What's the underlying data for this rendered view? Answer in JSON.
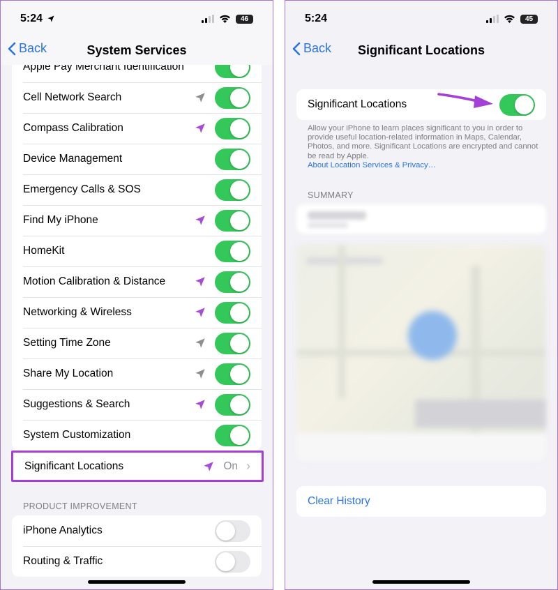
{
  "status_bar": {
    "time": "5:24",
    "battery": "46"
  },
  "status_bar_right": {
    "time": "5:24",
    "battery": "45"
  },
  "left_screen": {
    "back_label": "Back",
    "title": "System Services",
    "services": [
      {
        "label": "Apple Pay Merchant Identification",
        "arrow": "none",
        "toggle": "on"
      },
      {
        "label": "Cell Network Search",
        "arrow": "gray",
        "toggle": "on"
      },
      {
        "label": "Compass Calibration",
        "arrow": "purple",
        "toggle": "on"
      },
      {
        "label": "Device Management",
        "arrow": "none",
        "toggle": "on"
      },
      {
        "label": "Emergency Calls & SOS",
        "arrow": "none",
        "toggle": "on"
      },
      {
        "label": "Find My iPhone",
        "arrow": "purple",
        "toggle": "on"
      },
      {
        "label": "HomeKit",
        "arrow": "none",
        "toggle": "on"
      },
      {
        "label": "Motion Calibration & Distance",
        "arrow": "purple",
        "toggle": "on"
      },
      {
        "label": "Networking & Wireless",
        "arrow": "purple",
        "toggle": "on"
      },
      {
        "label": "Setting Time Zone",
        "arrow": "gray",
        "toggle": "on"
      },
      {
        "label": "Share My Location",
        "arrow": "gray",
        "toggle": "on"
      },
      {
        "label": "Suggestions & Search",
        "arrow": "purple",
        "toggle": "on"
      },
      {
        "label": "System Customization",
        "arrow": "none",
        "toggle": "on"
      }
    ],
    "significant_locations": {
      "label": "Significant Locations",
      "value": "On"
    },
    "product_improvement_header": "PRODUCT IMPROVEMENT",
    "product_improvement": [
      {
        "label": "iPhone Analytics",
        "toggle": "off"
      },
      {
        "label": "Routing & Traffic",
        "toggle": "off"
      }
    ]
  },
  "right_screen": {
    "back_label": "Back",
    "title": "Significant Locations",
    "toggle_label": "Significant Locations",
    "toggle_state": "on",
    "description": "Allow your iPhone to learn places significant to you in order to provide useful location-related information in Maps, Calendar, Photos, and more. Significant Locations are encrypted and cannot be read by Apple.",
    "privacy_link": "About Location Services & Privacy…",
    "summary_header": "SUMMARY",
    "clear_history": "Clear History"
  },
  "colors": {
    "toggle_on": "#34c759",
    "accent_blue": "#2a74e0",
    "highlight_purple": "#a43fd8",
    "location_arrow_purple": "#a54ad9",
    "location_arrow_gray": "#8e8e93"
  }
}
